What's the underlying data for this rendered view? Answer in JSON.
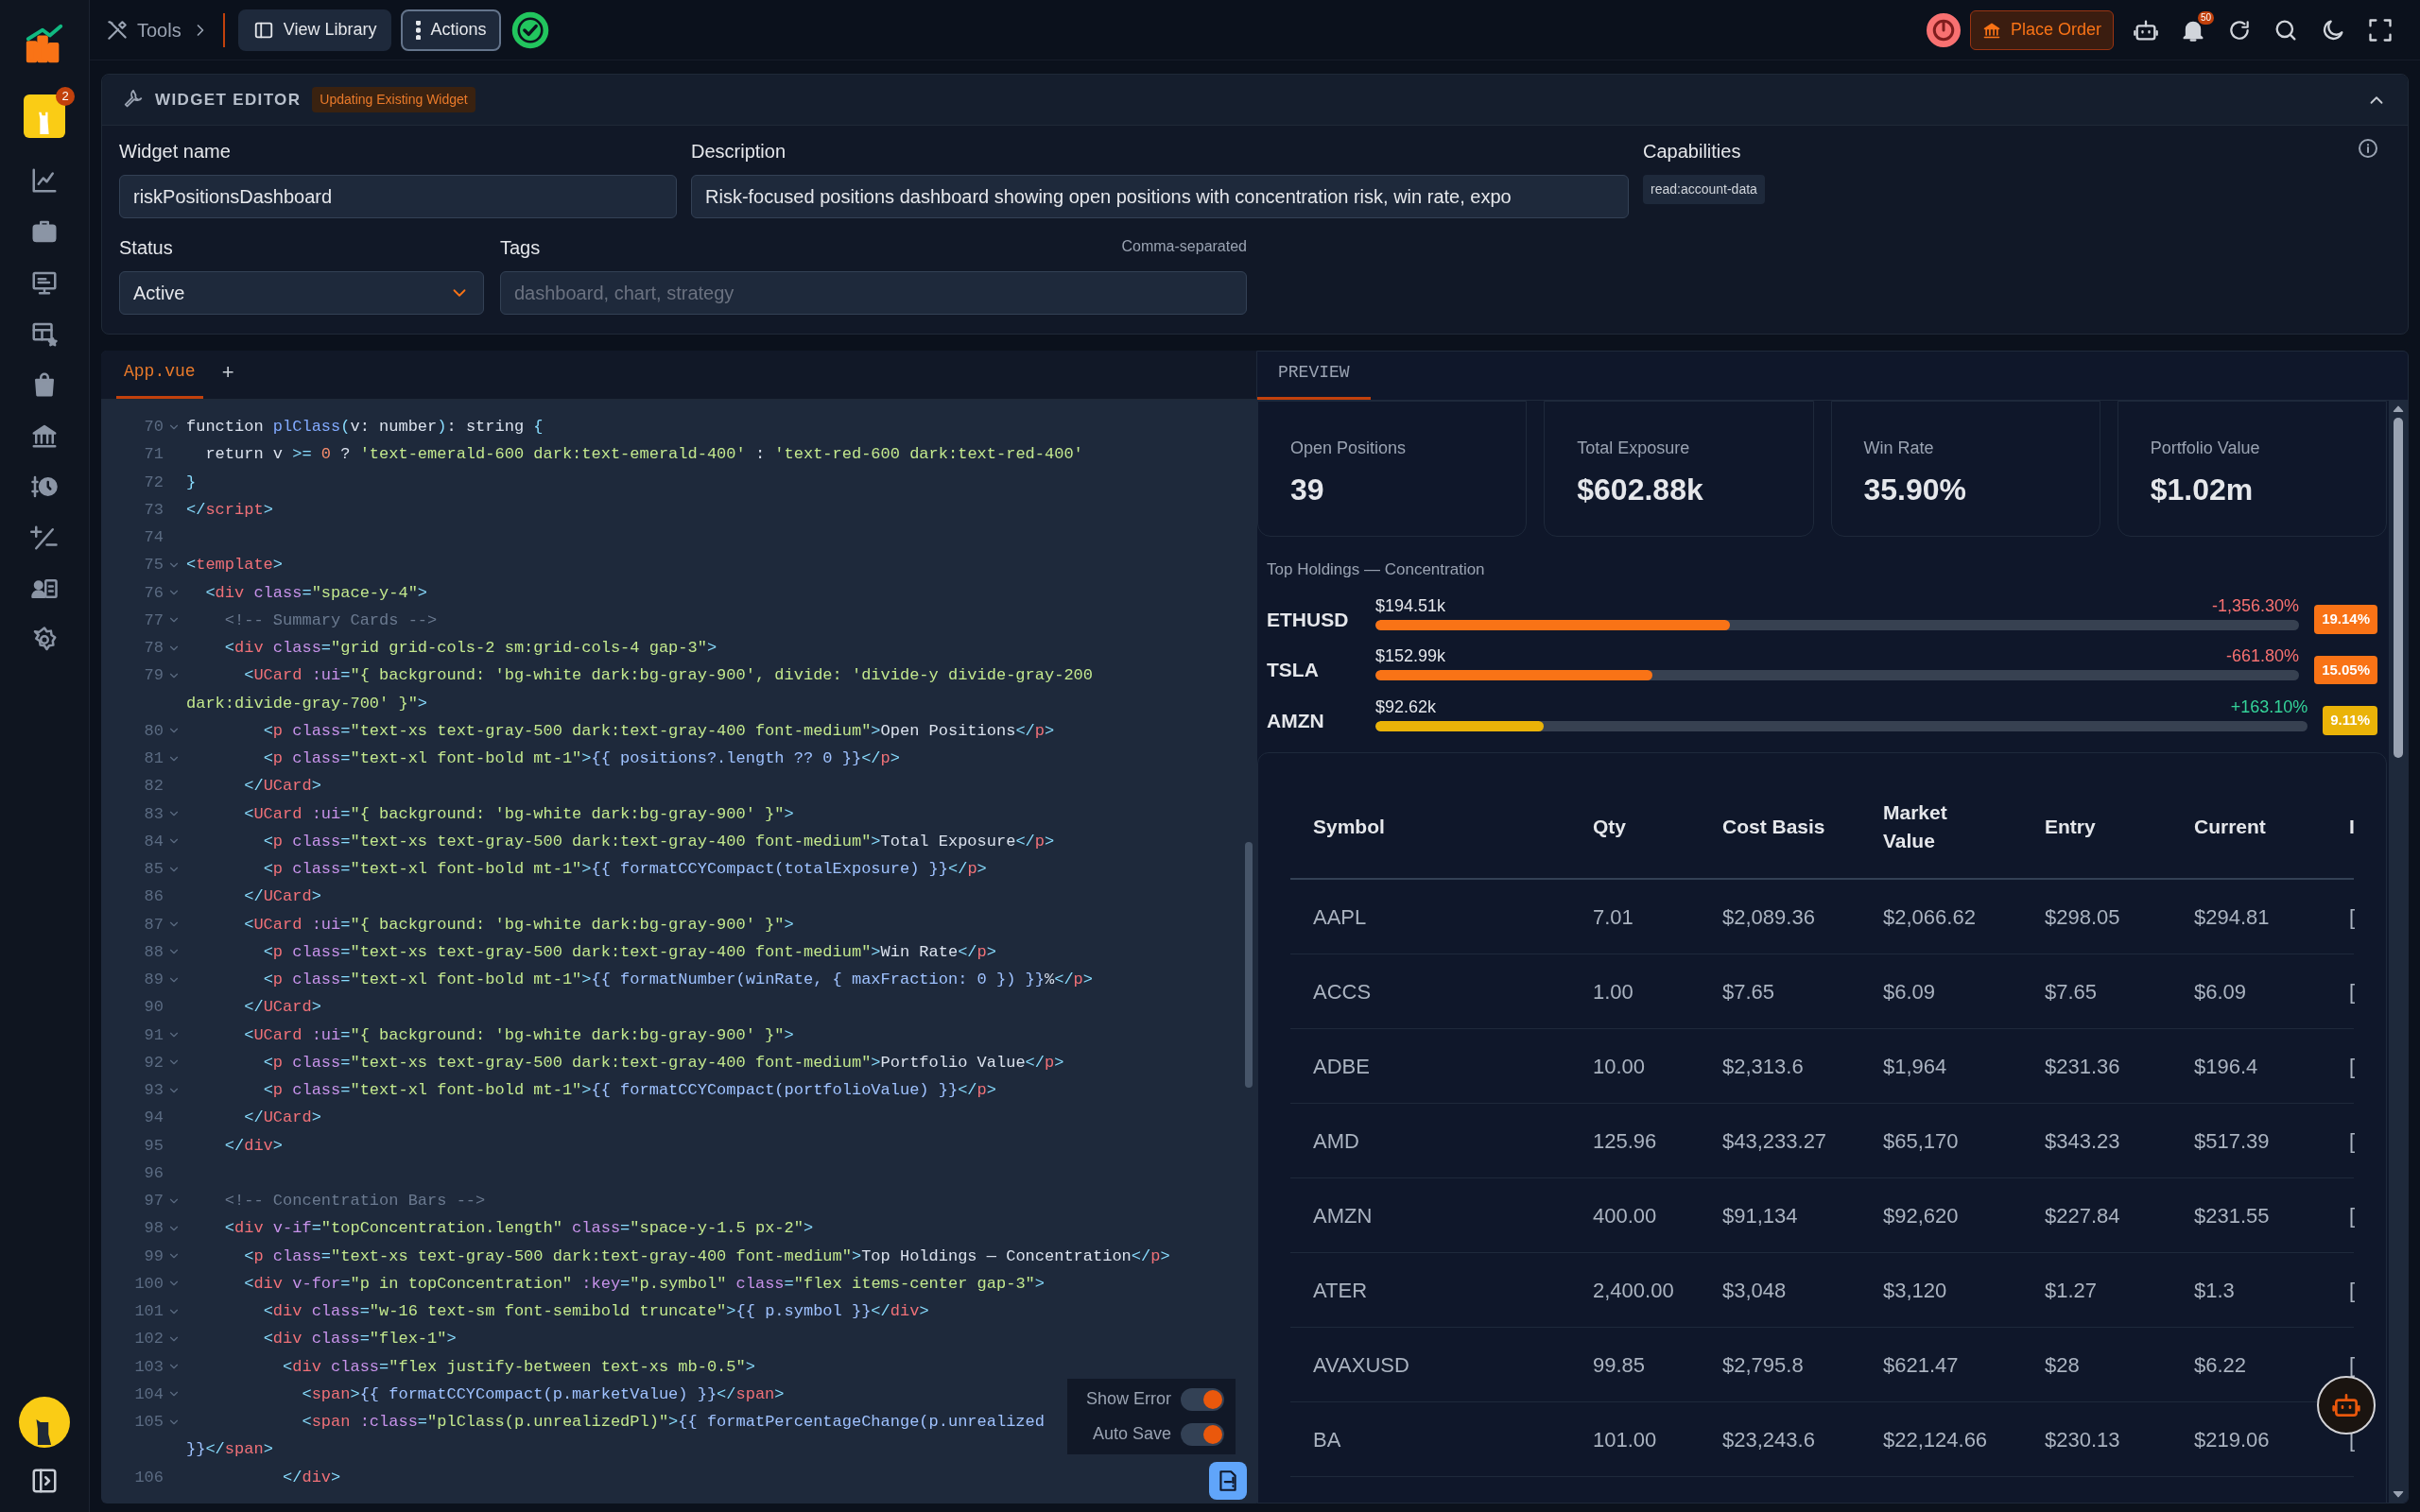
{
  "topbar": {
    "breadcrumb": "Tools",
    "buttons": [
      {
        "label": "View Library",
        "kind": "library",
        "selected": false
      },
      {
        "label": "Actions",
        "kind": "actions",
        "selected": true
      }
    ],
    "place_order": "Place Order",
    "notification_count": "50"
  },
  "sidebar": {
    "badge": "2",
    "items": [
      {
        "kind": "chart"
      },
      {
        "kind": "briefcase"
      },
      {
        "kind": "monitor"
      },
      {
        "kind": "widgets"
      },
      {
        "kind": "bag"
      },
      {
        "kind": "bank"
      },
      {
        "kind": "history"
      },
      {
        "kind": "plusminus"
      },
      {
        "kind": "contacts"
      },
      {
        "kind": "settings"
      }
    ]
  },
  "editor": {
    "title": "WIDGET EDITOR",
    "badge": "Updating Existing Widget",
    "widget_name": {
      "label": "Widget name",
      "value": "riskPositionsDashboard"
    },
    "description": {
      "label": "Description",
      "value": "Risk-focused positions dashboard showing open positions with concentration risk, win rate, expo"
    },
    "capabilities": {
      "label": "Capabilities",
      "tags": [
        "read:account-data"
      ]
    },
    "status": {
      "label": "Status",
      "value": "Active"
    },
    "tags": {
      "label": "Tags",
      "hint": "Comma-separated",
      "placeholder": "dashboard, chart, strategy"
    }
  },
  "code": {
    "tab": "App.vue",
    "add": "+",
    "lines": [
      {
        "num": "70",
        "fold": true,
        "text": "function plClass(v: number): string {"
      },
      {
        "num": "71",
        "fold": false,
        "text": "  return v >= 0 ? 'text-emerald-600 dark:text-emerald-400' : 'text-red-600 dark:text-red-400'"
      },
      {
        "num": "72",
        "fold": false,
        "text": "}"
      },
      {
        "num": "73",
        "fold": false,
        "text": "</script>"
      },
      {
        "num": "74",
        "fold": false
      },
      {
        "num": "75",
        "fold": true,
        "text": "<template>"
      },
      {
        "num": "76",
        "fold": true,
        "text": "  <div class=\"space-y-4\">"
      },
      {
        "num": "77",
        "fold": true,
        "text": "    <!-- Summary Cards -->"
      },
      {
        "num": "78",
        "fold": true,
        "text": "    <div class=\"grid grid-cols-2 sm:grid-cols-4 gap-3\">"
      },
      {
        "num": "79",
        "fold": true,
        "text": "      <UCard :ui=\"{ background: 'bg-white dark:bg-gray-900', divide: 'divide-y divide-gray-200",
        "cont": "dark:divide-gray-700' }\">"
      },
      {
        "num": "80",
        "fold": true,
        "text": "        <p class=\"text-xs text-gray-500 dark:text-gray-400 font-medium\">Open Positions</p>"
      },
      {
        "num": "81",
        "fold": true,
        "text": "        <p class=\"text-xl font-bold mt-1\">{{ positions?.length ?? 0 }}</p>"
      },
      {
        "num": "82",
        "fold": false,
        "text": "      </UCard>"
      },
      {
        "num": "83",
        "fold": true,
        "text": "      <UCard :ui=\"{ background: 'bg-white dark:bg-gray-900' }\">"
      },
      {
        "num": "84",
        "fold": true,
        "text": "        <p class=\"text-xs text-gray-500 dark:text-gray-400 font-medium\">Total Exposure</p>"
      },
      {
        "num": "85",
        "fold": true,
        "text": "        <p class=\"text-xl font-bold mt-1\">{{ formatCCYCompact(totalExposure) }}</p>"
      },
      {
        "num": "86",
        "fold": false,
        "text": "      </UCard>"
      },
      {
        "num": "87",
        "fold": true,
        "text": "      <UCard :ui=\"{ background: 'bg-white dark:bg-gray-900' }\">"
      },
      {
        "num": "88",
        "fold": true,
        "text": "        <p class=\"text-xs text-gray-500 dark:text-gray-400 font-medium\">Win Rate</p>"
      },
      {
        "num": "89",
        "fold": true,
        "text": "        <p class=\"text-xl font-bold mt-1\">{{ formatNumber(winRate, { maxFraction: 0 }) }}%</p>"
      },
      {
        "num": "90",
        "fold": false,
        "text": "      </UCard>"
      },
      {
        "num": "91",
        "fold": true,
        "text": "      <UCard :ui=\"{ background: 'bg-white dark:bg-gray-900' }\">"
      },
      {
        "num": "92",
        "fold": true,
        "text": "        <p class=\"text-xs text-gray-500 dark:text-gray-400 font-medium\">Portfolio Value</p>"
      },
      {
        "num": "93",
        "fold": true,
        "text": "        <p class=\"text-xl font-bold mt-1\">{{ formatCCYCompact(portfolioValue) }}</p>"
      },
      {
        "num": "94",
        "fold": false,
        "text": "      </UCard>"
      },
      {
        "num": "95",
        "fold": false,
        "text": "    </div>"
      },
      {
        "num": "96",
        "fold": false
      },
      {
        "num": "97",
        "fold": true,
        "text": "    <!-- Concentration Bars -->"
      },
      {
        "num": "98",
        "fold": true,
        "text": "    <div v-if=\"topConcentration.length\" class=\"space-y-1.5 px-2\">"
      },
      {
        "num": "99",
        "fold": true,
        "text": "      <p class=\"text-xs text-gray-500 dark:text-gray-400 font-medium\">Top Holdings — Concentration</p>"
      },
      {
        "num": "100",
        "fold": true,
        "text": "      <div v-for=\"p in topConcentration\" :key=\"p.symbol\" class=\"flex items-center gap-3\">"
      },
      {
        "num": "101",
        "fold": true,
        "text": "        <div class=\"w-16 text-sm font-semibold truncate\">{{ p.symbol }}</div>"
      },
      {
        "num": "102",
        "fold": true,
        "text": "        <div class=\"flex-1\">"
      },
      {
        "num": "103",
        "fold": true,
        "text": "          <div class=\"flex justify-between text-xs mb-0.5\">"
      },
      {
        "num": "104",
        "fold": true,
        "text": "            <span>{{ formatCCYCompact(p.marketValue) }}</span>"
      },
      {
        "num": "105",
        "fold": true,
        "text": "            <span :class=\"plClass(p.unrealizedPl)\">{{ formatPercentageChange(p.unrealized",
        "cont": "}}</span>"
      },
      {
        "num": "106",
        "fold": false,
        "text": "          </div>"
      }
    ],
    "toggles": [
      {
        "label": "Show Error",
        "on": true
      },
      {
        "label": "Auto Save",
        "on": true
      }
    ]
  },
  "preview": {
    "tab": "PREVIEW",
    "stats": [
      {
        "label": "Open Positions",
        "value": "39"
      },
      {
        "label": "Total Exposure",
        "value": "$602.88k"
      },
      {
        "label": "Win Rate",
        "value": "35.90%"
      },
      {
        "label": "Portfolio Value",
        "value": "$1.02m"
      }
    ],
    "holdings_title": "Top Holdings — Concentration",
    "holdings": [
      {
        "symbol": "ETHUSD",
        "value": "$194.51k",
        "change": "-1,356.30%",
        "loss": true,
        "share": "19.14%",
        "level": 0.384,
        "color": "#f97316"
      },
      {
        "symbol": "TSLA",
        "value": "$152.99k",
        "change": "-661.80%",
        "loss": true,
        "share": "15.05%",
        "level": 0.3,
        "color": "#f97316"
      },
      {
        "symbol": "AMZN",
        "value": "$92.62k",
        "change": "+163.10%",
        "loss": false,
        "share": "9.11%",
        "level": 0.18,
        "color": "#eab308"
      }
    ],
    "table": {
      "columns": [
        "Symbol",
        "Qty",
        "Cost Basis",
        "Market Value",
        "Entry",
        "Current",
        "I"
      ],
      "rows": [
        [
          "AAPL",
          "7.01",
          "$2,089.36",
          "$2,066.62",
          "$298.05",
          "$294.81",
          "["
        ],
        [
          "ACCS",
          "1.00",
          "$7.65",
          "$6.09",
          "$7.65",
          "$6.09",
          "["
        ],
        [
          "ADBE",
          "10.00",
          "$2,313.6",
          "$1,964",
          "$231.36",
          "$196.4",
          "["
        ],
        [
          "AMD",
          "125.96",
          "$43,233.27",
          "$65,170",
          "$343.23",
          "$517.39",
          "["
        ],
        [
          "AMZN",
          "400.00",
          "$91,134",
          "$92,620",
          "$227.84",
          "$231.55",
          "["
        ],
        [
          "ATER",
          "2,400.00",
          "$3,048",
          "$3,120",
          "$1.27",
          "$1.3",
          "["
        ],
        [
          "AVAXUSD",
          "99.85",
          "$2,795.8",
          "$621.47",
          "$28",
          "$6.22",
          "["
        ],
        [
          "BA",
          "101.00",
          "$23,243.6",
          "$22,124.66",
          "$230.13",
          "$219.06",
          "["
        ]
      ]
    }
  }
}
